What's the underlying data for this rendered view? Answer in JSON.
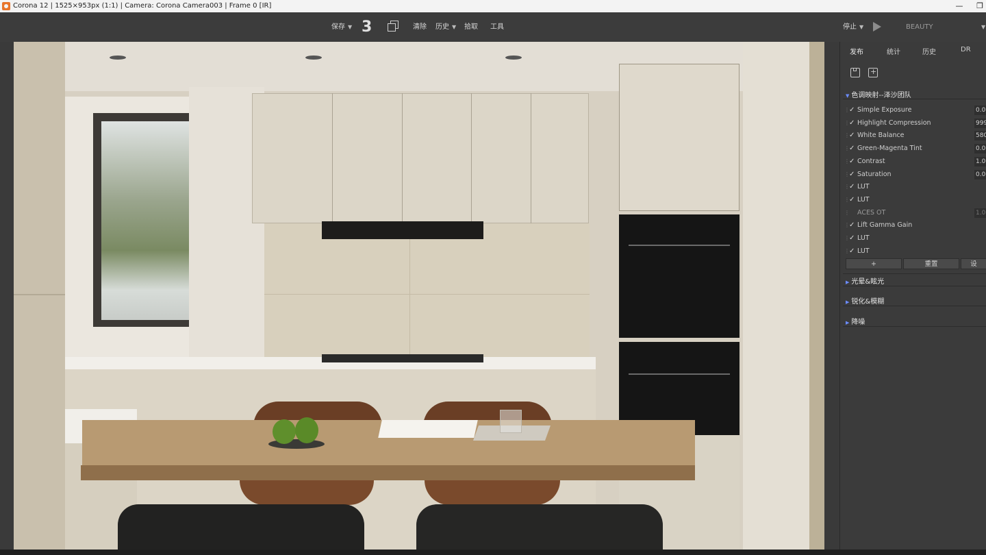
{
  "titlebar": {
    "title": "Corona 12 | 1525×953px (1:1) | Camera: Corona Camera003 | Frame 0 [IR]",
    "minimize": "—",
    "restore": "❐"
  },
  "toolbar": {
    "save_label": "保存",
    "number": "3",
    "clear_label": "清除",
    "history_label": "历史",
    "pick_label": "拾取",
    "tools_label": "工具",
    "stop_label": "停止",
    "pass_label": "BEAUTY"
  },
  "panel": {
    "tabs": [
      "发布",
      "统计",
      "历史",
      "DR"
    ],
    "tonemapping_title": "色调映射--泽沙团队",
    "operators": [
      {
        "checked": true,
        "label": "Simple Exposure",
        "value": "0.0"
      },
      {
        "checked": true,
        "label": "Highlight Compression",
        "value": "999"
      },
      {
        "checked": true,
        "label": "White Balance",
        "value": "580"
      },
      {
        "checked": true,
        "label": "Green-Magenta Tint",
        "value": "0.0"
      },
      {
        "checked": true,
        "label": "Contrast",
        "value": "1.0"
      },
      {
        "checked": true,
        "label": "Saturation",
        "value": "0.0"
      },
      {
        "checked": true,
        "label": "LUT",
        "value": ""
      },
      {
        "checked": true,
        "label": "LUT",
        "value": ""
      },
      {
        "checked": false,
        "label": "ACES OT",
        "value": "1.0"
      },
      {
        "checked": true,
        "label": "Lift Gamma Gain",
        "value": ""
      },
      {
        "checked": true,
        "label": "LUT",
        "value": ""
      },
      {
        "checked": true,
        "label": "LUT",
        "value": ""
      }
    ],
    "buttons": {
      "add": "+",
      "reset": "重置",
      "more": "设"
    },
    "sections": [
      "光晕&眩光",
      "锐化&模糊",
      "降噪"
    ]
  }
}
